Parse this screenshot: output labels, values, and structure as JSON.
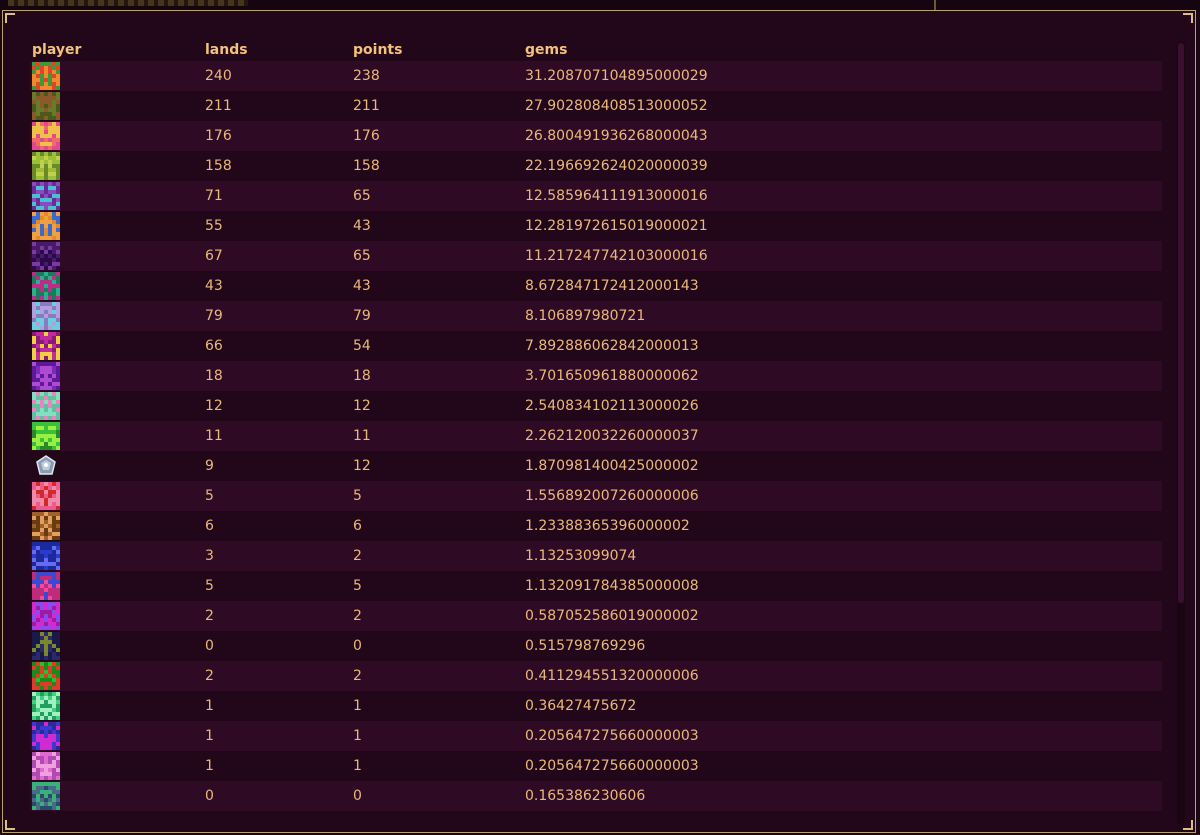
{
  "table": {
    "headers": {
      "player": "player",
      "lands": "lands",
      "points": "points",
      "gems": "gems"
    },
    "rows": [
      {
        "avatar": "pixel-avatar-orange-green",
        "lands": "240",
        "points": "238",
        "gems": "31.208707104895000029"
      },
      {
        "avatar": "pixel-avatar-olive-brown",
        "lands": "211",
        "points": "211",
        "gems": "27.902808408513000052"
      },
      {
        "avatar": "pixel-avatar-salmon-yellow",
        "lands": "176",
        "points": "176",
        "gems": "26.800491936268000043"
      },
      {
        "avatar": "pixel-avatar-lime-olive",
        "lands": "158",
        "points": "158",
        "gems": "22.196692624020000039"
      },
      {
        "avatar": "pixel-avatar-purple-cyan",
        "lands": "71",
        "points": "65",
        "gems": "12.585964111913000016"
      },
      {
        "avatar": "pixel-avatar-orange-blue",
        "lands": "55",
        "points": "43",
        "gems": "12.281972615019000021"
      },
      {
        "avatar": "pixel-avatar-dark-purple",
        "lands": "67",
        "points": "65",
        "gems": "11.217247742103000016"
      },
      {
        "avatar": "pixel-avatar-teal-magenta",
        "lands": "43",
        "points": "43",
        "gems": "8.672847172412000143"
      },
      {
        "avatar": "pixel-avatar-lavender-cyan",
        "lands": "79",
        "points": "79",
        "gems": "8.106897980721"
      },
      {
        "avatar": "pixel-avatar-magenta-yellow",
        "lands": "66",
        "points": "54",
        "gems": "7.892886062842000013"
      },
      {
        "avatar": "pixel-avatar-purple-violet",
        "lands": "18",
        "points": "18",
        "gems": "3.701650961880000062"
      },
      {
        "avatar": "pixel-avatar-mint-pink",
        "lands": "12",
        "points": "12",
        "gems": "2.540834102113000026"
      },
      {
        "avatar": "pixel-avatar-green-lime",
        "lands": "11",
        "points": "11",
        "gems": "2.262120032260000037"
      },
      {
        "avatar": "gem-icon",
        "lands": "9",
        "points": "12",
        "gems": "1.870981400425000002"
      },
      {
        "avatar": "pixel-avatar-pink-red",
        "lands": "5",
        "points": "5",
        "gems": "1.556892007260000006"
      },
      {
        "avatar": "pixel-avatar-brown-tan",
        "lands": "6",
        "points": "6",
        "gems": "1.23388365396000002"
      },
      {
        "avatar": "pixel-avatar-blue-indigo",
        "lands": "3",
        "points": "2",
        "gems": "1.13253099074"
      },
      {
        "avatar": "pixel-avatar-pink-blue",
        "lands": "5",
        "points": "5",
        "gems": "1.132091784385000008"
      },
      {
        "avatar": "pixel-avatar-magenta-violet",
        "lands": "2",
        "points": "2",
        "gems": "0.587052586019000002"
      },
      {
        "avatar": "pixel-avatar-navy-olive",
        "lands": "0",
        "points": "0",
        "gems": "0.515798769296"
      },
      {
        "avatar": "pixel-avatar-green-red",
        "lands": "2",
        "points": "2",
        "gems": "0.411294551320000006"
      },
      {
        "avatar": "pixel-avatar-mint-green",
        "lands": "1",
        "points": "1",
        "gems": "0.36427475672"
      },
      {
        "avatar": "pixel-avatar-blue-magenta",
        "lands": "1",
        "points": "1",
        "gems": "0.205647275660000003"
      },
      {
        "avatar": "pixel-avatar-pink-orchid",
        "lands": "1",
        "points": "1",
        "gems": "0.205647275660000003"
      },
      {
        "avatar": "pixel-avatar-slate-green",
        "lands": "0",
        "points": "0",
        "gems": "0.165386230606"
      }
    ]
  },
  "colors": {
    "background": "#22071a",
    "row_alt": "#2f0a24",
    "header_text": "#f3c27a",
    "cell_text": "#e9b97a",
    "frame": "#b9a36a"
  }
}
